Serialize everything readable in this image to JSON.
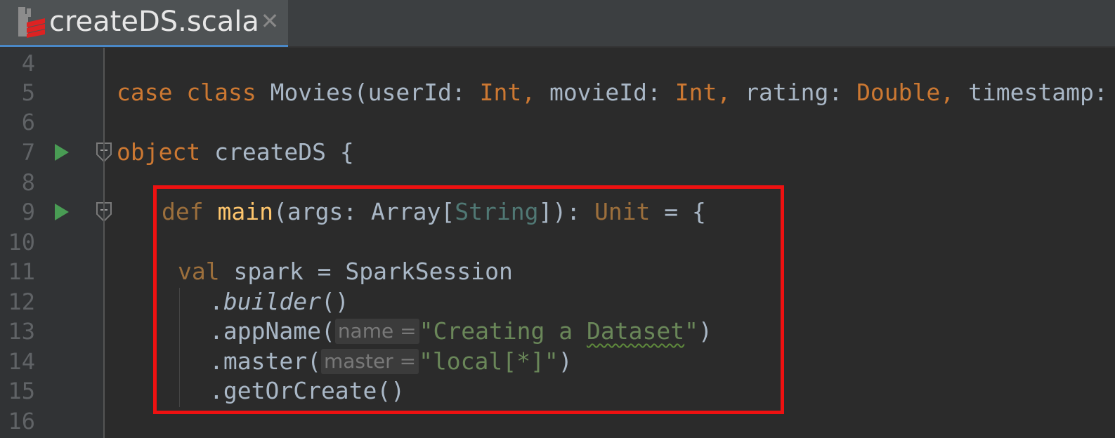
{
  "tab": {
    "title": "createDS.scala",
    "close_glyph": "✕",
    "icon": "scala-file-icon"
  },
  "gutter": {
    "line_numbers": [
      "4",
      "5",
      "6",
      "7",
      "8",
      "9",
      "10",
      "11",
      "12",
      "13",
      "14",
      "15",
      "16"
    ],
    "run_markers_on_lines": [
      "7",
      "9"
    ],
    "fold_markers_on_lines": [
      "7",
      "9"
    ]
  },
  "code": {
    "l5": {
      "case": "case",
      "class": "class",
      "sig": " Movies(userId: ",
      "t1": "Int,",
      "mid": " movieId: ",
      "t2": "Int,",
      "mid2": " rating: ",
      "t3": "Double,",
      "rest": " timestamp: Long)"
    },
    "l7": {
      "object": "object",
      "rest": " createDS {"
    },
    "l9": {
      "def": "def",
      "name": "main",
      "sig1": "(args: Array[",
      "tparam": "String",
      "sig2": "]): ",
      "ret": "Unit",
      "rest": " = {"
    },
    "l11": {
      "val": "val",
      "rest": " spark = SparkSession"
    },
    "l12": {
      "dot": ".",
      "method": "builder",
      "rest": "()"
    },
    "l13": {
      "pre": ".appName(",
      "hint": "name =",
      "q1": "\"Creating a ",
      "typo": "Dataset",
      "q2": "\"",
      "rest": ")"
    },
    "l14": {
      "pre": ".master(",
      "hint": "master =",
      "str": "\"local[*]\"",
      "rest": ")"
    },
    "l15": {
      "text": ".getOrCreate()"
    }
  },
  "colors": {
    "background": "#2b2b2b",
    "keyword": "#cc7832",
    "function": "#ffc66d",
    "string": "#6a8759",
    "highlight_box": "#ee1111",
    "tab_underline": "#4a88c7"
  }
}
